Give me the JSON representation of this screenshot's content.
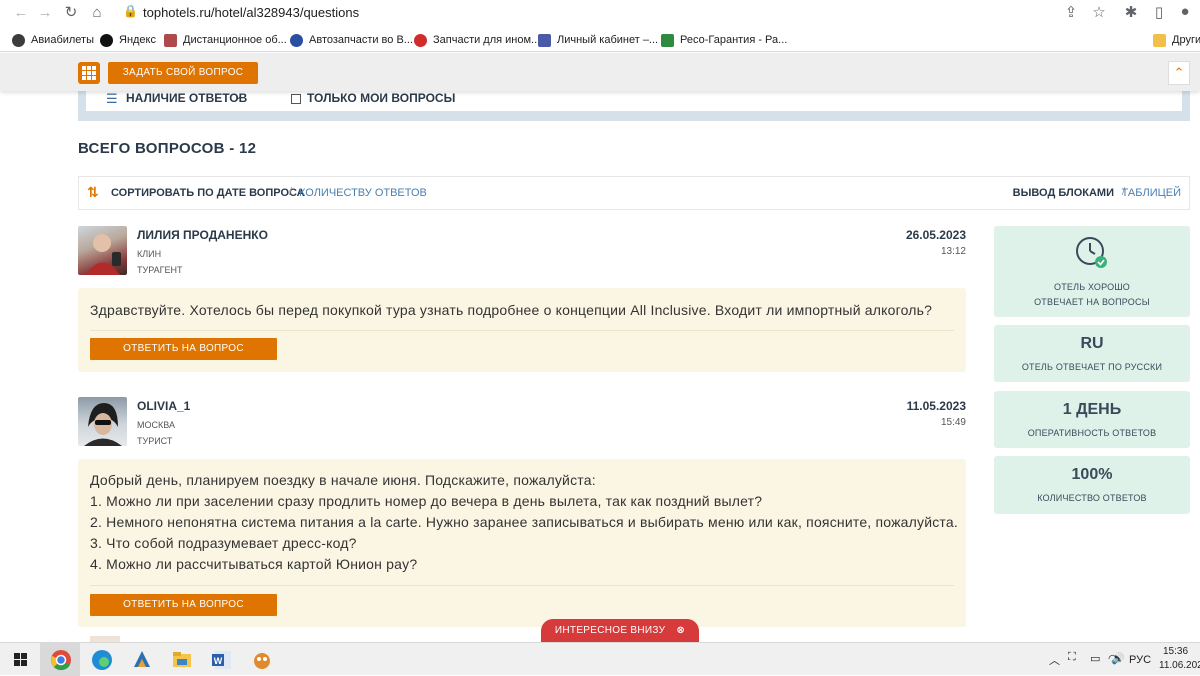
{
  "browser": {
    "url": "tophotels.ru/hotel/al328943/questions",
    "bookmarks": [
      {
        "label": "Авиабилеты",
        "color": "#3c3c3c"
      },
      {
        "label": "Яндекс",
        "color": "#111111"
      },
      {
        "label": "Дистанционное об...",
        "color": "#b04a4a"
      },
      {
        "label": "Автозапчасти во В...",
        "color": "#2a4fa0"
      },
      {
        "label": "Запчасти для ином...",
        "color": "#d22b2b"
      },
      {
        "label": "Личный кабинет –...",
        "color": "#4a5aa8"
      },
      {
        "label": "Ресо-Гарантия - Ра...",
        "color": "#2e8b3d"
      }
    ],
    "other_bookmarks": "Другие"
  },
  "header": {
    "ask_label": "ЗАДАТЬ СВОЙ ВОПРОС"
  },
  "filters": {
    "answers_label": "НАЛИЧИЕ ОТВЕТОВ",
    "my_label": "ТОЛЬКО МОИ ВОПРОСЫ"
  },
  "total_label": "ВСЕГО ВОПРОСОВ - 12",
  "sort": {
    "label": "СОРТИРОВАТЬ ПО ДАТЕ ВОПРОСА",
    "alt": "КОЛИЧЕСТВУ ОТВЕТОВ",
    "view_label": "ВЫВОД БЛОКАМИ",
    "view_alt": "ТАБЛИЦЕЙ"
  },
  "questions": [
    {
      "name": "ЛИЛИЯ ПРОДАНЕНКО",
      "city": "КЛИН",
      "role": "ТУРАГЕНТ",
      "date": "26.05.2023",
      "time": "13:12",
      "lines": [
        "Здравствуйте. Хотелось бы перед покупкой тура узнать подробнее о концепции All Inclusive. Входит ли импортный алкоголь?"
      ],
      "button": "ОТВЕТИТЬ НА ВОПРОС"
    },
    {
      "name": "OLIVIA_1",
      "city": "МОСКВА",
      "role": "ТУРИСТ",
      "date": "11.05.2023",
      "time": "15:49",
      "lines": [
        "Добрый день, планируем поездку в начале июня. Подскажите, пожалуйста:",
        "1. Можно ли при заселении сразу продлить номер до вечера в день вылета, так как поздний вылет?",
        "2. Немного непонятна система питания a la carte. Нужно заранее записываться и выбирать меню или как, поясните, пожалуйста.",
        "3. Что собой подразумевает дресс-код?",
        "4. Можно ли рассчитываться картой Юнион pay?"
      ],
      "button": "ОТВЕТИТЬ НА ВОПРОС"
    }
  ],
  "stats": {
    "good_line1": "ОТЕЛЬ ХОРОШО",
    "good_line2": "ОТВЕЧАЕТ НА ВОПРОСЫ",
    "lang_big": "RU",
    "lang_small": "ОТЕЛЬ ОТВЕЧАЕТ ПО РУССКИ",
    "speed_big": "1 ДЕНЬ",
    "speed_small": "ОПЕРАТИВНОСТЬ ОТВЕТОВ",
    "count_big": "100%",
    "count_small": "КОЛИЧЕСТВО ОТВЕТОВ"
  },
  "banner": "ИНТЕРЕСНОЕ ВНИЗУ",
  "taskbar": {
    "lang": "РУС",
    "time": "15:36",
    "date": "11.06.202"
  }
}
